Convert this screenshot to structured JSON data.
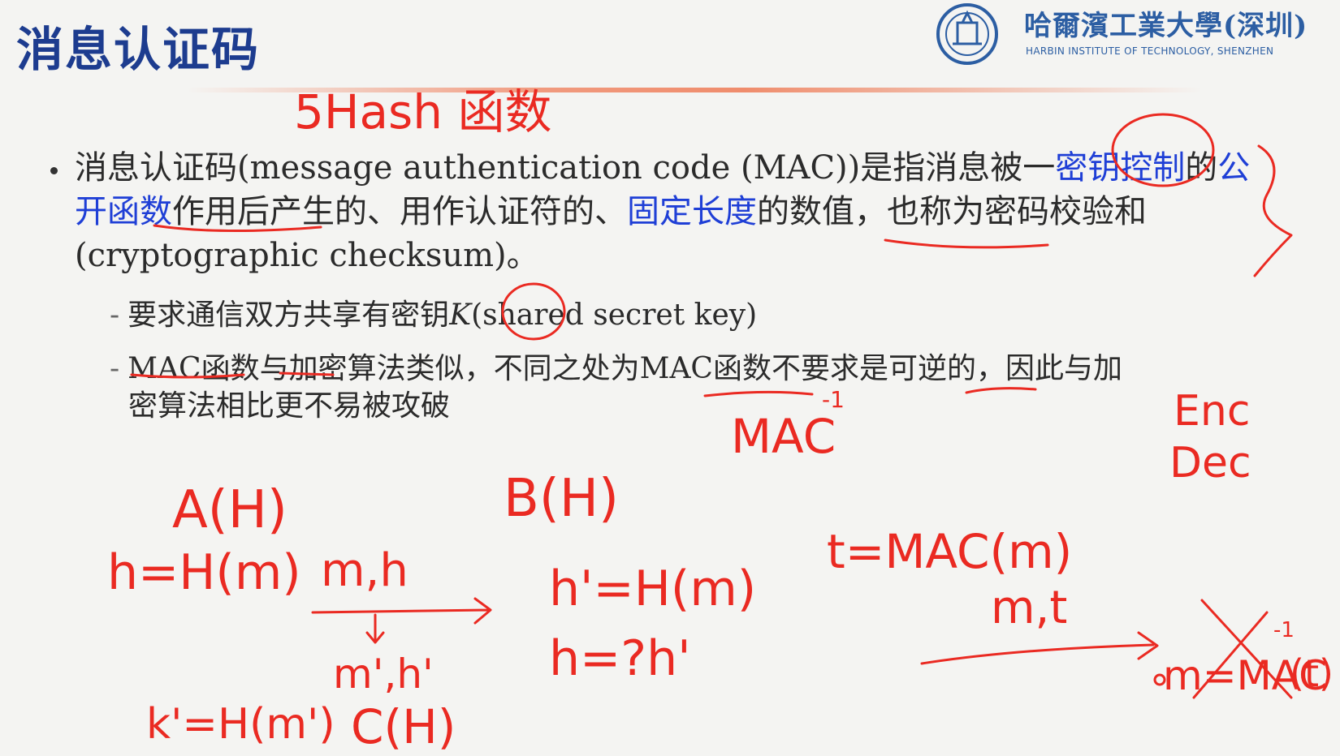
{
  "slide": {
    "title": "消息认证码",
    "logo": {
      "name_cn": "哈爾濱工業大學(深圳)",
      "name_en": "HARBIN INSTITUTE OF TECHNOLOGY, SHENZHEN"
    },
    "bullet": {
      "seg1": "消息认证码(message authentication code (MAC))是指消息被一",
      "seg2": "密钥控制",
      "seg3": "的",
      "seg4": "公开函数",
      "seg5": "作用后产生的、用作认证符的、",
      "seg6": "固定长度",
      "seg7": "的数值，也称为密码校验和(cryptographic checksum)。"
    },
    "sub1": {
      "dash": "-",
      "text_a": "要求通信双方共享有密钥",
      "key_symbol": "K",
      "text_b": "(shared secret key)"
    },
    "sub2": {
      "dash": "-",
      "line1": "MAC函数与加密算法类似，不同之处为MAC函数不要求是可逆的，因此与加",
      "line2": "密算法相比更不易被攻破"
    }
  },
  "annotations": {
    "top_note": "5Hash 函数",
    "mac_inverse": "MAC",
    "inverse_sup": "-1",
    "enc": "Enc",
    "dec": "Dec",
    "party_a": "A(H)",
    "party_b": "B(H)",
    "party_c": "C(H)",
    "h_eq": "h=H(m)",
    "m_h": "m,h",
    "m_h_prime": "m',h'",
    "h_prime_eq": "h'=H(m)",
    "h_check": "h=?h'",
    "k_eq": "k'=H(m')",
    "t_eq": "t=MAC(m)",
    "m_t": "m,t",
    "m_mac_inv": "m=MAC",
    "mac_inv_t": "(t)"
  },
  "colors": {
    "title": "#1d3c8f",
    "highlight": "#1f3fd6",
    "ink": "#ea2a22",
    "logo": "#2c5ea3",
    "background": "#f4f4f2"
  }
}
